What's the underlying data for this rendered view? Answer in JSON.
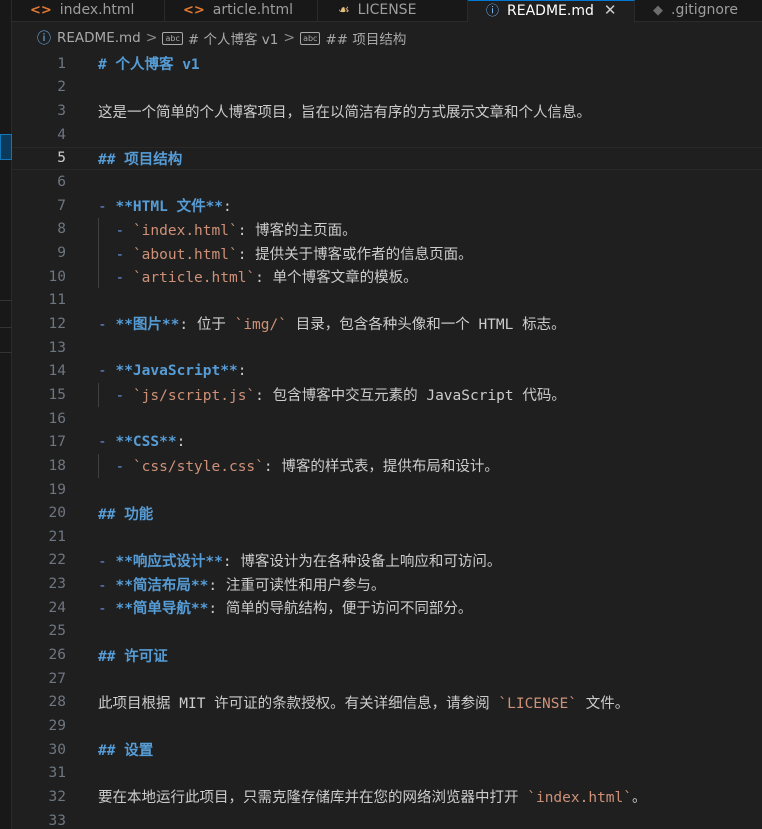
{
  "tabs": [
    {
      "label": "index.html",
      "icon": "code-icon",
      "glyph": "<>",
      "active": false
    },
    {
      "label": "article.html",
      "icon": "code-icon",
      "glyph": "<>",
      "active": false
    },
    {
      "label": "LICENSE",
      "icon": "license-icon",
      "glyph": "☙",
      "active": false
    },
    {
      "label": "README.md",
      "icon": "info-icon",
      "glyph": "ⓘ",
      "active": true,
      "close_glyph": "✕"
    },
    {
      "label": ".gitignore",
      "icon": "git-icon",
      "glyph": "◆",
      "active": false
    }
  ],
  "breadcrumb": {
    "file": "README.md",
    "sep": ">",
    "sym1_glyph": "abc",
    "item1": "# 个人博客 v1",
    "sym2_glyph": "abc",
    "item2": "## 项目结构"
  },
  "editor": {
    "current_line": 5,
    "lines": [
      [
        {
          "c": "h",
          "t": "# 个人博客 v1"
        }
      ],
      [],
      [
        {
          "c": "t",
          "t": "这是一个简单的个人博客项目，旨在以简洁有序的方式展示文章和个人信息。"
        }
      ],
      [],
      [
        {
          "c": "h",
          "t": "## 项目结构"
        }
      ],
      [],
      [
        {
          "c": "dash",
          "t": "- "
        },
        {
          "c": "b",
          "t": "**HTML 文件**"
        },
        {
          "c": "t",
          "t": ":"
        }
      ],
      [
        {
          "c": "t",
          "t": "  "
        },
        {
          "c": "dash",
          "t": "- "
        },
        {
          "c": "code",
          "t": "`index.html`"
        },
        {
          "c": "t",
          "t": ": 博客的主页面。"
        }
      ],
      [
        {
          "c": "t",
          "t": "  "
        },
        {
          "c": "dash",
          "t": "- "
        },
        {
          "c": "code",
          "t": "`about.html`"
        },
        {
          "c": "t",
          "t": ": 提供关于博客或作者的信息页面。"
        }
      ],
      [
        {
          "c": "t",
          "t": "  "
        },
        {
          "c": "dash",
          "t": "- "
        },
        {
          "c": "code",
          "t": "`article.html`"
        },
        {
          "c": "t",
          "t": ": 单个博客文章的模板。"
        }
      ],
      [],
      [
        {
          "c": "dash",
          "t": "- "
        },
        {
          "c": "b",
          "t": "**图片**"
        },
        {
          "c": "t",
          "t": ": 位于 "
        },
        {
          "c": "code",
          "t": "`img/`"
        },
        {
          "c": "t",
          "t": " 目录，包含各种头像和一个 HTML 标志。"
        }
      ],
      [],
      [
        {
          "c": "dash",
          "t": "- "
        },
        {
          "c": "b",
          "t": "**JavaScript**"
        },
        {
          "c": "t",
          "t": ":"
        }
      ],
      [
        {
          "c": "t",
          "t": "  "
        },
        {
          "c": "dash",
          "t": "- "
        },
        {
          "c": "code",
          "t": "`js/script.js`"
        },
        {
          "c": "t",
          "t": ": 包含博客中交互元素的 JavaScript 代码。"
        }
      ],
      [],
      [
        {
          "c": "dash",
          "t": "- "
        },
        {
          "c": "b",
          "t": "**CSS**"
        },
        {
          "c": "t",
          "t": ":"
        }
      ],
      [
        {
          "c": "t",
          "t": "  "
        },
        {
          "c": "dash",
          "t": "- "
        },
        {
          "c": "code",
          "t": "`css/style.css`"
        },
        {
          "c": "t",
          "t": ": 博客的样式表，提供布局和设计。"
        }
      ],
      [],
      [
        {
          "c": "h",
          "t": "## 功能"
        }
      ],
      [],
      [
        {
          "c": "dash",
          "t": "- "
        },
        {
          "c": "b",
          "t": "**响应式设计**"
        },
        {
          "c": "t",
          "t": ": 博客设计为在各种设备上响应和可访问。"
        }
      ],
      [
        {
          "c": "dash",
          "t": "- "
        },
        {
          "c": "b",
          "t": "**简洁布局**"
        },
        {
          "c": "t",
          "t": ": 注重可读性和用户参与。"
        }
      ],
      [
        {
          "c": "dash",
          "t": "- "
        },
        {
          "c": "b",
          "t": "**简单导航**"
        },
        {
          "c": "t",
          "t": ": 简单的导航结构，便于访问不同部分。"
        }
      ],
      [],
      [
        {
          "c": "h",
          "t": "## 许可证"
        }
      ],
      [],
      [
        {
          "c": "t",
          "t": "此项目根据 MIT 许可证的条款授权。有关详细信息，请参阅 "
        },
        {
          "c": "code",
          "t": "`LICENSE`"
        },
        {
          "c": "t",
          "t": " 文件。"
        }
      ],
      [],
      [
        {
          "c": "h",
          "t": "## 设置"
        }
      ],
      [],
      [
        {
          "c": "t",
          "t": "要在本地运行此项目，只需克隆存储库并在您的网络浏览器中打开 "
        },
        {
          "c": "code",
          "t": "`index.html`"
        },
        {
          "c": "t",
          "t": "。"
        }
      ],
      []
    ]
  },
  "colors": {
    "background": "#1f1f1f",
    "heading": "#569cd6",
    "inline_code": "#ce9178",
    "text": "#cccccc",
    "line_number": "#6e7681",
    "active_tab_border": "#0078d4"
  }
}
